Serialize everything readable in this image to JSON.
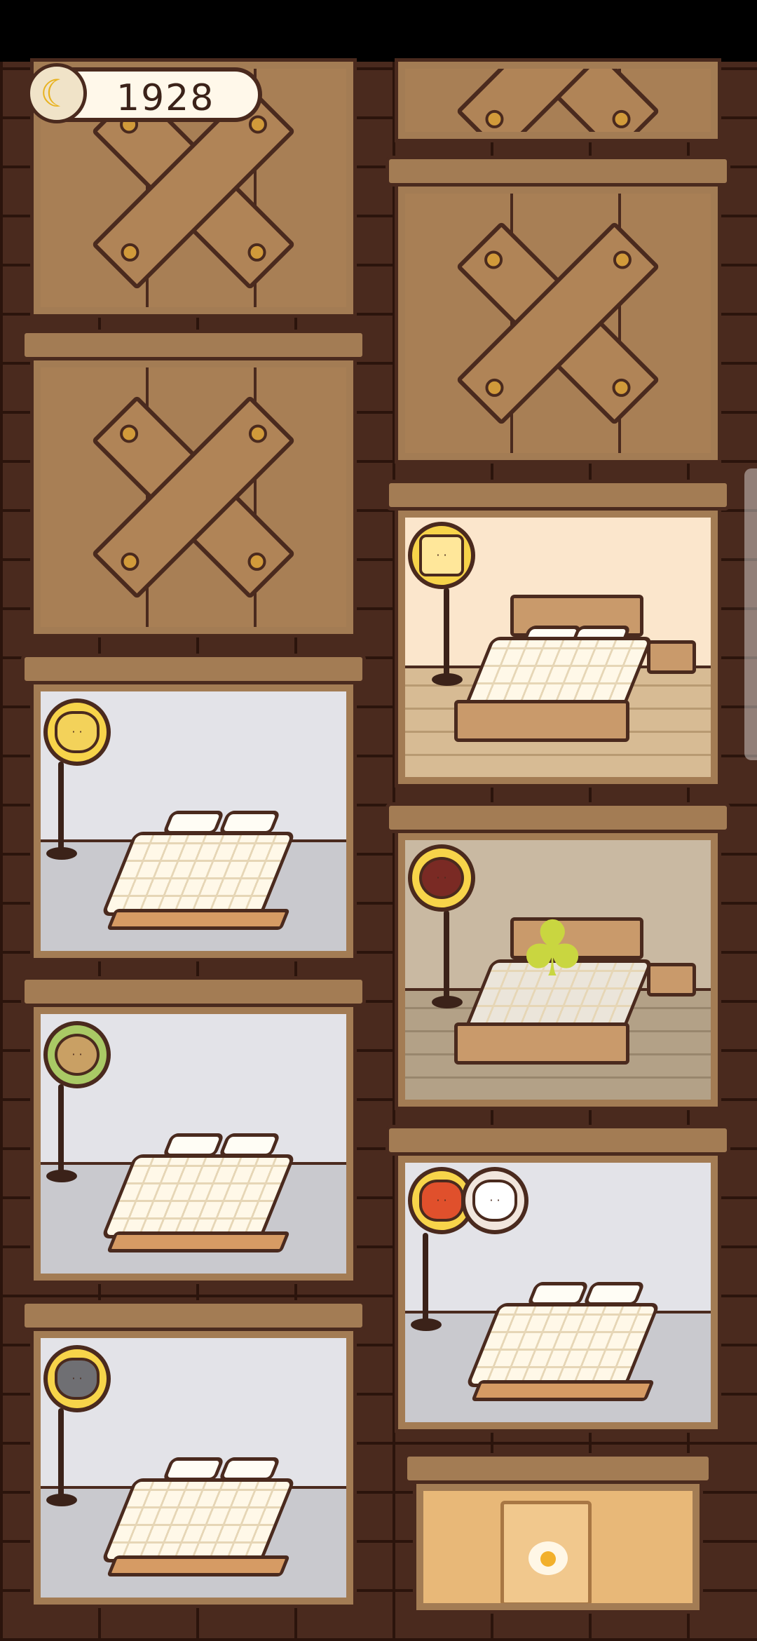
{
  "hud": {
    "currency_icon": "banana-icon",
    "currency_value": "1928"
  },
  "rooms": [
    {
      "id": "left-1",
      "state": "boarded"
    },
    {
      "id": "left-2",
      "state": "boarded"
    },
    {
      "id": "left-3",
      "state": "open",
      "theme": "gray",
      "resident": "pudding-dog"
    },
    {
      "id": "left-4",
      "state": "open",
      "theme": "gray",
      "resident": "sunflower"
    },
    {
      "id": "left-5",
      "state": "open",
      "theme": "gray",
      "resident": "gray-bunny"
    },
    {
      "id": "right-1",
      "state": "boarded"
    },
    {
      "id": "right-2",
      "state": "boarded"
    },
    {
      "id": "right-3",
      "state": "open",
      "theme": "warm",
      "resident": "robot-cat"
    },
    {
      "id": "right-4",
      "state": "open",
      "theme": "dim",
      "resident": "red-bird",
      "guest": "clover"
    },
    {
      "id": "right-5",
      "state": "open",
      "theme": "gray",
      "resident": "burger",
      "guest": "bunny"
    },
    {
      "id": "right-6",
      "state": "kitchen"
    }
  ],
  "colors": {
    "wall": "#4a2a1e",
    "wood": "#a87f55",
    "portrait_ring": "#f7d44a",
    "accent_banana": "#e8b21f"
  }
}
